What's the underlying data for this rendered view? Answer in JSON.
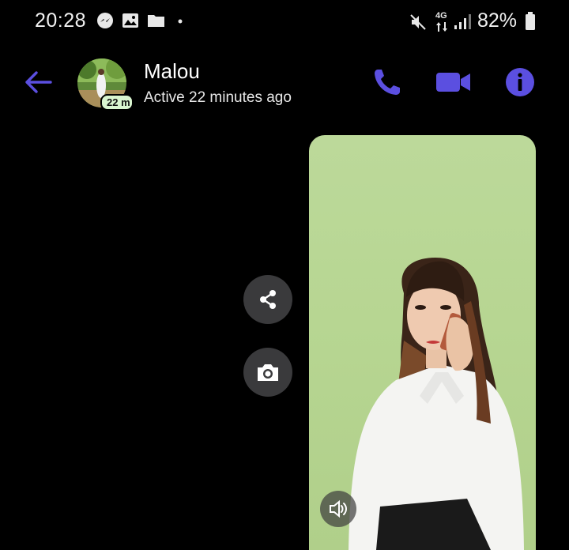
{
  "status_bar": {
    "time": "20:28",
    "notification_icons": [
      "messenger-icon",
      "gallery-icon",
      "folder-icon",
      "dot-icon"
    ],
    "network": "4G",
    "battery_percent": "82%",
    "mute_icon": "sound-off-icon"
  },
  "header": {
    "contact_name": "Malou",
    "contact_status": "Active 22 minutes ago",
    "avatar_badge": "22 m",
    "accent_color": "#5b4fe0"
  },
  "message": {
    "type": "video",
    "actions": [
      "share-icon",
      "camera-icon"
    ],
    "video_controls": [
      "volume-icon"
    ]
  }
}
